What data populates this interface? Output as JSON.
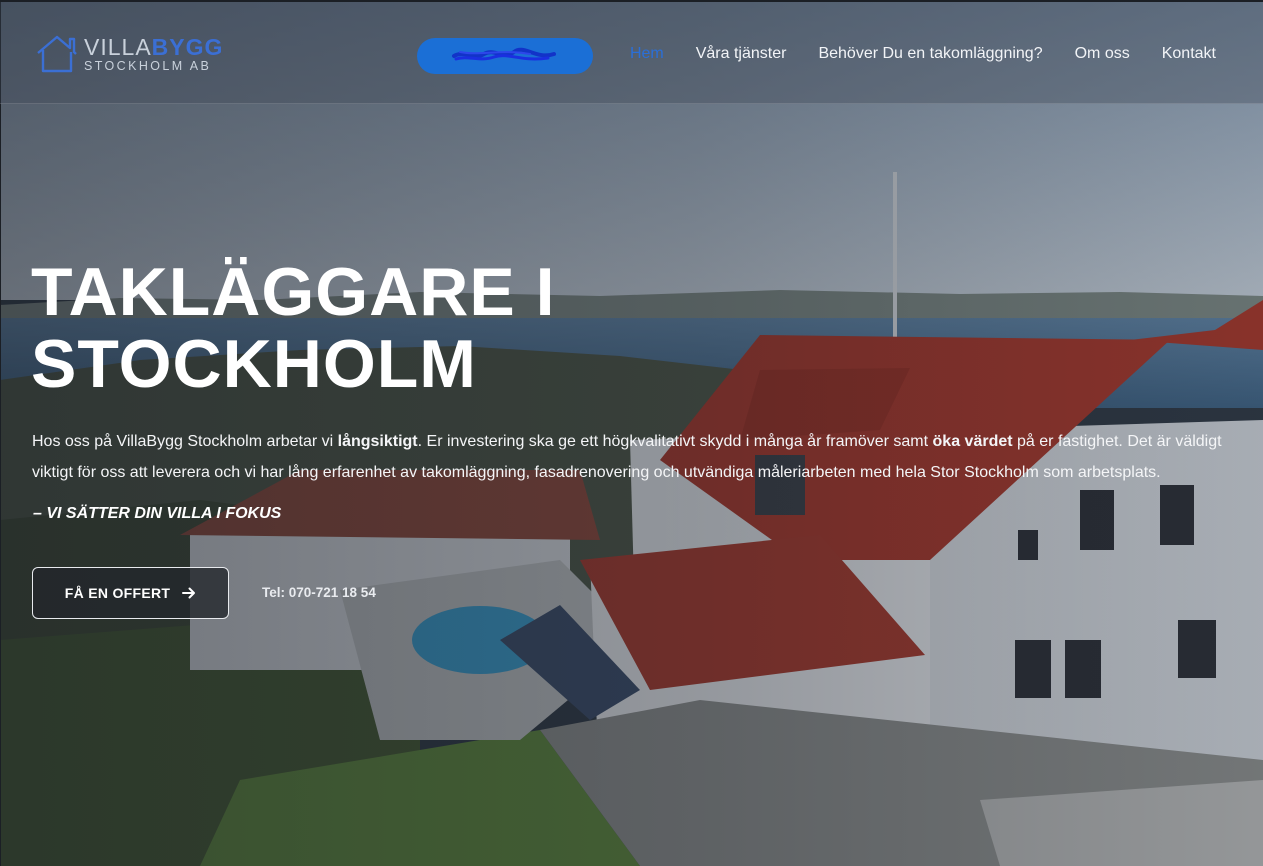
{
  "header": {
    "logo": {
      "line1_prefix": "VILLA",
      "line1_suffix": "BYGG",
      "line2": "STOCKHOLM AB"
    },
    "redacted_pill_color": "#1b6fd6",
    "nav": [
      {
        "label": "Hem",
        "active": true
      },
      {
        "label": "Våra tjänster",
        "active": false
      },
      {
        "label": "Behöver Du en takomläggning?",
        "active": false
      },
      {
        "label": "Om oss",
        "active": false
      },
      {
        "label": "Kontakt",
        "active": false
      }
    ]
  },
  "hero": {
    "headline_line1": "TAKLÄGGARE I",
    "headline_line2": "STOCKHOLM",
    "intro": {
      "p1": "Hos oss på VillaBygg Stockholm arbetar vi ",
      "b1": "långsiktigt",
      "p2": ". Er investering ska ge ett högkvalitativt skydd i många år framöver samt ",
      "b2": "öka värdet",
      "p3": " på er fastighet. Det är väldigt viktigt för oss att leverera och vi har lång erfarenhet av takomläggning, fasadrenovering och utvändiga måleriarbeten med hela Stor Stockholm som arbetsplats."
    },
    "tagline": "– VI SÄTTER DIN VILLA I FOKUS",
    "cta_label": "FÅ EN OFFERT",
    "phone": "Tel: 070-721 18 54"
  },
  "colors": {
    "accent": "#2a6fd8",
    "roof": "#a8382c",
    "overlay": "#181c24"
  }
}
